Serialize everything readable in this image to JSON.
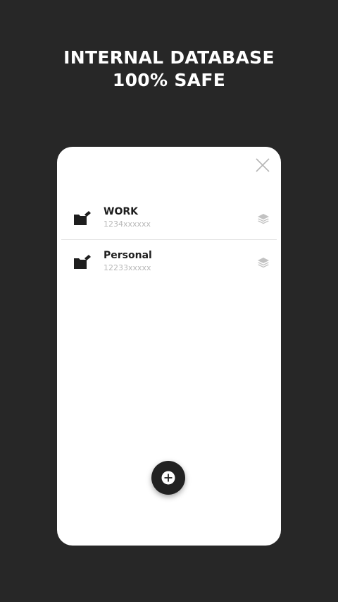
{
  "headline": {
    "line1": "INTERNAL DATABASE",
    "line2": "100% SAFE"
  },
  "card": {
    "close_icon": "close-icon",
    "items": [
      {
        "title": "WORK",
        "subtitle": "1234xxxxxx",
        "icon": "folder-icon",
        "action_icon": "layers-icon"
      },
      {
        "title": "Personal",
        "subtitle": "12233xxxxx",
        "icon": "folder-icon",
        "action_icon": "layers-icon"
      }
    ],
    "add_button_icon": "add-icon"
  },
  "colors": {
    "background": "#272727",
    "card": "#ffffff",
    "fab": "#222222",
    "subtitle": "#b8b8b8"
  }
}
